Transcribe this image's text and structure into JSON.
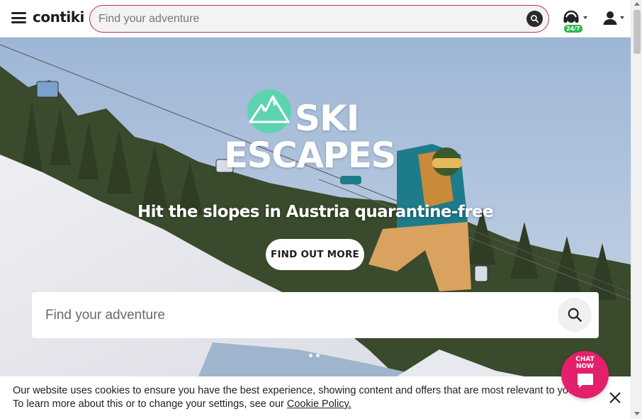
{
  "header": {
    "logo_text": "contiki",
    "search_placeholder": "Find your adventure",
    "support_badge": "24/7"
  },
  "hero": {
    "title_line1": "SKI",
    "title_line2": "ESCAPES",
    "subtitle": "Hit the slopes in Austria quarantine-free",
    "cta_label": "FIND OUT MORE",
    "search_placeholder": "Find your adventure",
    "slide_count": 2,
    "accent_color": "#5ed3b1"
  },
  "cookie": {
    "text": "Our website uses cookies to ensure you have the best experience, showing content and offers that are most relevant to you. To learn more about this or to change your settings, see our",
    "link_label": "Cookie Policy."
  },
  "chat": {
    "label_line1": "CHAT",
    "label_line2": "NOW",
    "color": "#e4206c"
  },
  "colors": {
    "search_border": "#b3336b",
    "support_badge": "#2db84b"
  }
}
